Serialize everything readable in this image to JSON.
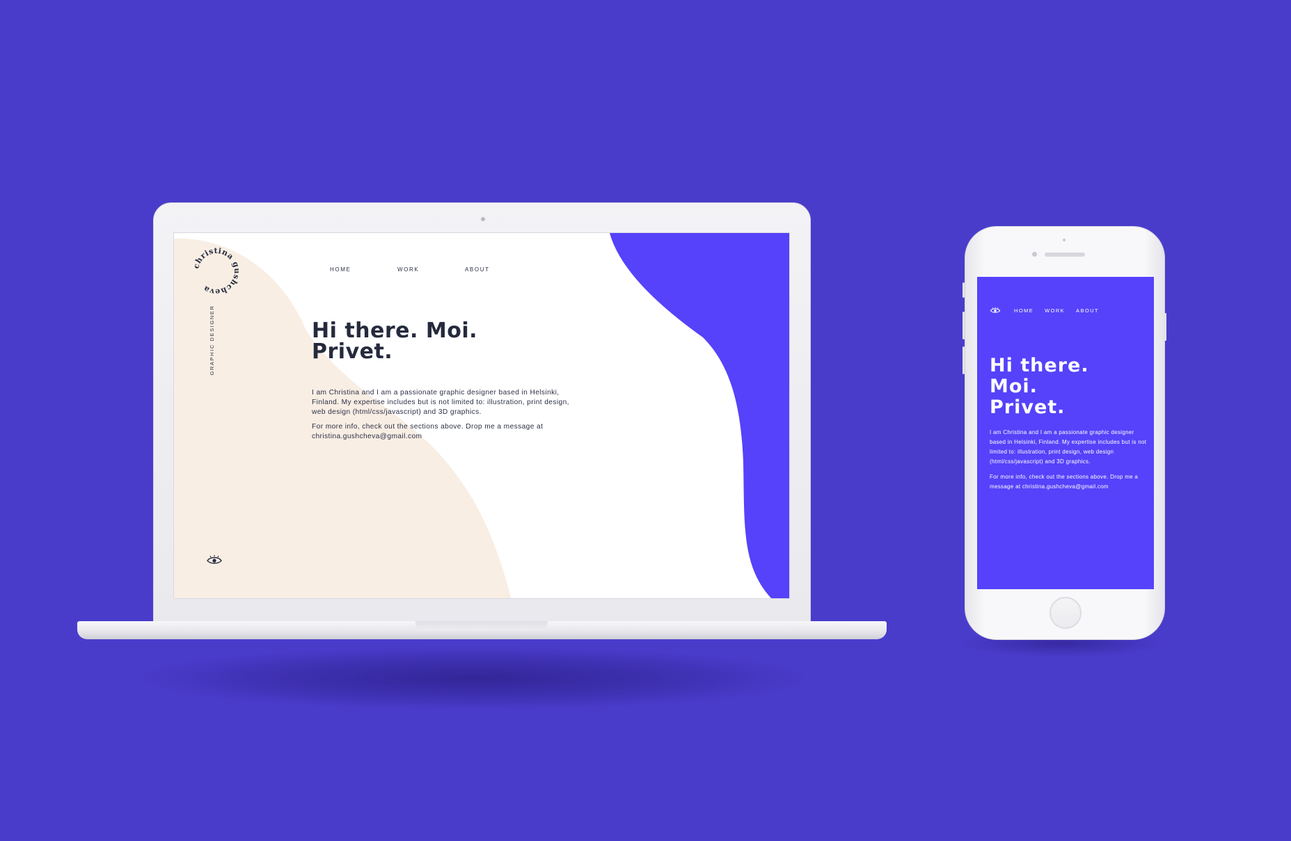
{
  "colors": {
    "background": "#4a3ccb",
    "accent_blue": "#5542fa",
    "beige": "#f8eee4",
    "text_dark": "#252a3d",
    "white": "#ffffff"
  },
  "laptop": {
    "logo_text": "christina gushcheva",
    "vertical_label": "GRAPHIC DESIGNER",
    "nav": [
      {
        "label": "HOME"
      },
      {
        "label": "WORK"
      },
      {
        "label": "ABOUT"
      }
    ],
    "hero_line1": "Hi there. Moi.",
    "hero_line2": "Privet.",
    "body_p1": "I am Christina and I am a passionate graphic designer based in Helsinki, Finland. My expertise includes but is not limited to: illustration, print design, web design (html/css/javascript) and 3D graphics.",
    "body_p2": "For more info, check out the sections above. Drop me a message at christina.gushcheva@gmail.com",
    "icons": {
      "logo": "circular-text-logo",
      "eye": "eye-icon"
    }
  },
  "phone": {
    "nav": [
      {
        "label": "HOME"
      },
      {
        "label": "WORK"
      },
      {
        "label": "ABOUT"
      }
    ],
    "hero_line1": "Hi there.",
    "hero_line2": "Moi.",
    "hero_line3": "Privet.",
    "body_p1": "I am Christina and I am a passionate graphic designer based in Helsinki, Finland. My expertise includes but is not limited to: illustration, print design, web design (html/css/javascript) and 3D graphics.",
    "body_p2": "For more info, check out the sections above. Drop me a message at christina.gushcheva@gmail.com",
    "icons": {
      "eye": "eye-icon"
    }
  }
}
